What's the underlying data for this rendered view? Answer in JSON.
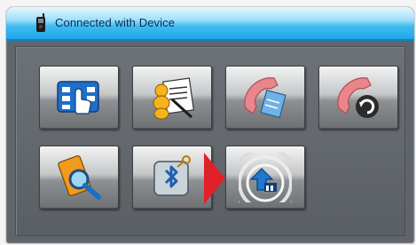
{
  "window": {
    "title": "Connected with Device",
    "title_icon": "mobile-phone-icon"
  },
  "tiles": [
    {
      "name": "phonebook-touch",
      "icon": "keypad-touch-icon"
    },
    {
      "name": "contacts-notes",
      "icon": "contact-card-icon"
    },
    {
      "name": "call-log",
      "icon": "phone-receiver-book-icon"
    },
    {
      "name": "call-sync",
      "icon": "phone-receiver-sync-icon"
    },
    {
      "name": "search-device",
      "icon": "search-phone-icon"
    },
    {
      "name": "bluetooth-settings",
      "icon": "bluetooth-device-icon"
    },
    {
      "name": "upload",
      "icon": "upload-arrow-icon"
    }
  ],
  "colors": {
    "titlebar_accent": "#1fa8e6",
    "panel": "#60656b",
    "pointer": "#e2202a"
  }
}
